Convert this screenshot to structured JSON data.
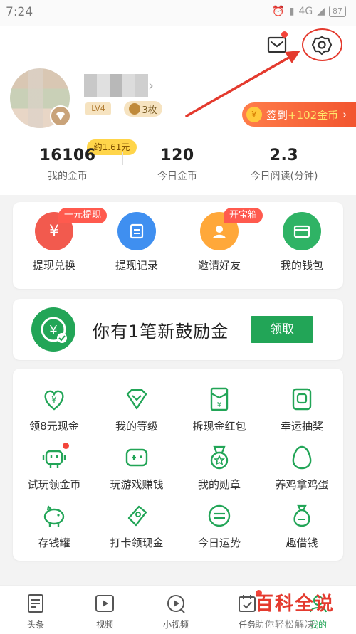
{
  "status_bar": {
    "time": "7:24",
    "network": "4G",
    "battery": "87"
  },
  "profile": {
    "level": "LV4",
    "medals": "3枚"
  },
  "checkin": {
    "label": "签到",
    "amount": "+102金币",
    "chevron": "›"
  },
  "stats": {
    "coin_tip": "约1.61元",
    "items": [
      {
        "value": "16106",
        "label": "我的金币"
      },
      {
        "value": "120",
        "label": "今日金币"
      },
      {
        "value": "2.3",
        "label": "今日阅读(分钟)"
      }
    ]
  },
  "quick_actions": [
    {
      "label": "提现兑换",
      "tag": "一元提现",
      "color": "#f25a4e",
      "icon": "yuan-icon"
    },
    {
      "label": "提现记录",
      "tag": "",
      "color": "#3f8ff0",
      "icon": "record-icon"
    },
    {
      "label": "邀请好友",
      "tag": "开宝箱",
      "color": "#ffa83a",
      "icon": "friend-icon"
    },
    {
      "label": "我的钱包",
      "tag": "",
      "color": "#2fb365",
      "icon": "wallet-icon"
    }
  ],
  "bonus": {
    "text": "你有1笔新鼓励金",
    "button": "领取"
  },
  "features": [
    {
      "label": "领8元现金"
    },
    {
      "label": "我的等级"
    },
    {
      "label": "拆现金红包"
    },
    {
      "label": "幸运抽奖"
    },
    {
      "label": "试玩领金币"
    },
    {
      "label": "玩游戏赚钱"
    },
    {
      "label": "我的勋章"
    },
    {
      "label": "养鸡拿鸡蛋"
    },
    {
      "label": "存钱罐"
    },
    {
      "label": "打卡领现金"
    },
    {
      "label": "今日运势"
    },
    {
      "label": "趣借钱"
    }
  ],
  "tabs": [
    {
      "label": "头条"
    },
    {
      "label": "视频"
    },
    {
      "label": "小视频"
    },
    {
      "label": "任务"
    },
    {
      "label": "我的"
    }
  ],
  "watermark": {
    "title": "百科全说",
    "subtitle": "助你轻松解决"
  },
  "colors": {
    "brand_green": "#22a557",
    "accent_red": "#e43a2e",
    "checkin_orange": "#f2552f"
  }
}
